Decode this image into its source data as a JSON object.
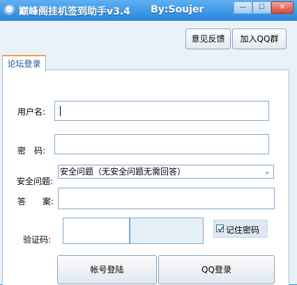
{
  "window": {
    "title": "巅峰阁挂机签到助手v3.4",
    "author": "By:Soujer",
    "controls": {
      "minimize": "—",
      "maximize": "☐",
      "close": "✕"
    }
  },
  "toolbar": {
    "feedback_label": "意见反馈",
    "join_qq_label": "加入QQ群"
  },
  "tabs": [
    {
      "label": "论坛登录",
      "active": true
    }
  ],
  "form": {
    "username_label": "用户名:",
    "username_value": "",
    "password_label": "密　码:",
    "password_value": "",
    "security_question_label": "安全问题:",
    "security_question_value": "安全问题（无安全问题无需回答）",
    "answer_label": "答　　案:",
    "answer_value": "",
    "captcha_label": "验证码:",
    "captcha_value": "",
    "remember_label": "记住密码",
    "remember_checked": true
  },
  "actions": {
    "login_label": "帐号登陆",
    "qq_login_label": "QQ登录"
  },
  "colors": {
    "titlebar": "#2a86dc",
    "window_bg": "#e9f2fb",
    "tab_accent": "#f0a23b"
  }
}
